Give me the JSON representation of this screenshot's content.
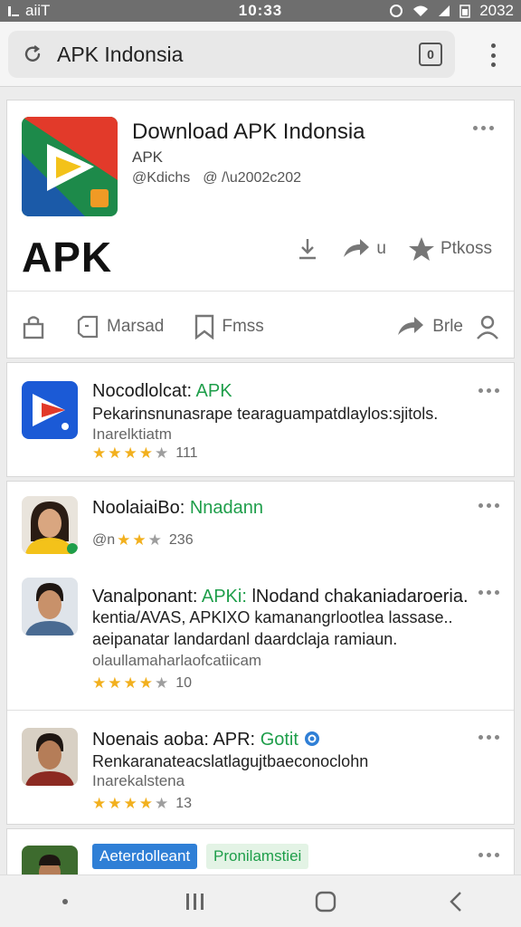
{
  "status_bar": {
    "carrier": "aiiT",
    "time": "10:33",
    "battery": "2032"
  },
  "url_bar": {
    "url": "APK Indonsia",
    "tabs_count": "0"
  },
  "header": {
    "title": "Download APK Indonsia",
    "subtitle": "APK",
    "meta_left": "@Kdichs",
    "meta_right": "@ /\\u2002c202",
    "big_label": "APK",
    "action_save": "",
    "action_share": "u",
    "action_favorite": "Ptkoss",
    "tool_1": "Marsad",
    "tool_2": "Fmss",
    "tool_3": "Brle"
  },
  "list": [
    {
      "title_prefix": "Nocodlolcat: ",
      "title_highlight": "APK",
      "desc": "Pekarinsnunasrape tearaguampatdlaylos:sjitols.",
      "sub": "Inarelktiatm",
      "stars": 4,
      "rating_count": "111"
    },
    {
      "title_prefix": "NoolaiaiBo: ",
      "title_highlight": "Nnadann",
      "rating_prefix": "@n",
      "stars": 2,
      "rating_count": "236"
    },
    {
      "title_prefix": "Vanalponant: ",
      "title_highlight": "APKi:",
      "title_suffix": " lNodand chakaniadaroeria.",
      "line2": "kentia/AVAS, APKIXO kamanangrlootlea lassase..",
      "line3": "aeipanatar landardanl daardclaja ramiaun.",
      "sub": "olaullamaharlaofcatiicam",
      "stars": 4,
      "rating_count": "10"
    },
    {
      "title_prefix": "Noenais aoba: APR: ",
      "title_highlight": "Gotit",
      "desc": "Renkaranateacslatlagujtbaeconoclohn",
      "sub": "Inarekalstena",
      "stars": 4,
      "rating_count": "13"
    }
  ],
  "bottom_item": {
    "badge_1": "Aeterdolleant",
    "badge_2": "Pronilamstiei"
  },
  "colors": {
    "accent_green": "#1e9e4a",
    "star": "#f2b01e",
    "badge_blue": "#2f7fd6"
  }
}
